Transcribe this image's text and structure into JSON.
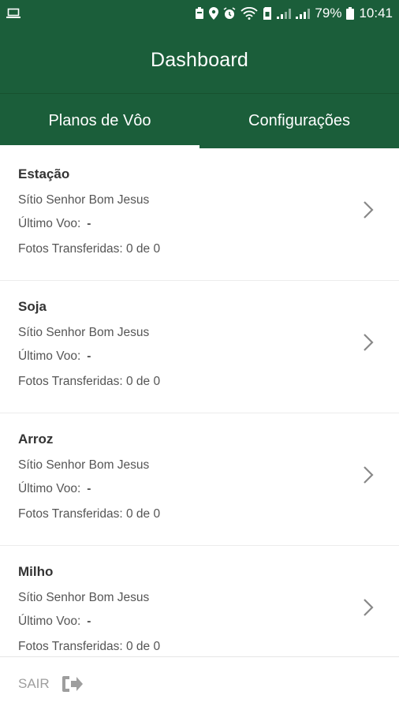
{
  "status_bar": {
    "battery_percent": "79%",
    "time": "10:41"
  },
  "header": {
    "title": "Dashboard"
  },
  "tabs": [
    {
      "label": "Planos de Vôo",
      "active": true
    },
    {
      "label": "Configurações",
      "active": false
    }
  ],
  "plans": [
    {
      "title": "Estação",
      "farm": "Sítio Senhor Bom Jesus",
      "last_flight_label": "Último Voo:",
      "last_flight_value": "-",
      "photos_text": "Fotos Transferidas: 0 de 0"
    },
    {
      "title": "Soja",
      "farm": "Sítio Senhor Bom Jesus",
      "last_flight_label": "Último Voo:",
      "last_flight_value": "-",
      "photos_text": "Fotos Transferidas: 0 de 0"
    },
    {
      "title": "Arroz",
      "farm": "Sítio Senhor Bom Jesus",
      "last_flight_label": "Último Voo:",
      "last_flight_value": "-",
      "photos_text": "Fotos Transferidas: 0 de 0"
    },
    {
      "title": "Milho",
      "farm": "Sítio Senhor Bom Jesus",
      "last_flight_label": "Último Voo:",
      "last_flight_value": "-",
      "photos_text": "Fotos Transferidas: 0 de 0"
    }
  ],
  "footer": {
    "logout_label": "SAIR"
  },
  "icons": {
    "chevron": "chevron-right-icon",
    "logout": "logout-icon"
  },
  "colors": {
    "primary": "#1b5e3a",
    "text_dark": "#333333",
    "text_muted": "#555555",
    "footer_text": "#9e9e9e"
  }
}
